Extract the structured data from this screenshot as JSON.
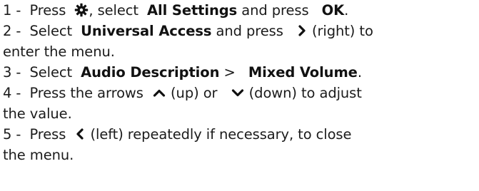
{
  "steps": [
    {
      "num": "1 -",
      "press": "Press",
      "icon1": "gear-icon",
      "sel": ", select",
      "all_settings": "All Settings",
      "and_press": "and press",
      "ok": "OK",
      "dot": "."
    },
    {
      "num": "2 -",
      "select": "Select",
      "universal_access": "Universal Access",
      "and_press": "and press",
      "icon1": "chevron-right-icon",
      "right": "(right) to",
      "cont": "enter the menu."
    },
    {
      "num": "3 -",
      "select": "Select",
      "audio_description": "Audio Description",
      "gt": ">",
      "mixed_volume": "Mixed Volume",
      "dot": "."
    },
    {
      "num": "4 -",
      "press_arrows": "Press the arrows",
      "icon1": "chevron-up-icon",
      "up_or": "(up) or",
      "icon2": "chevron-down-icon",
      "down": "(down) to adjust",
      "cont": "the value."
    },
    {
      "num": "5 -",
      "press": "Press",
      "icon1": "chevron-left-icon",
      "left": "(left) repeatedly if necessary, to close",
      "cont": "the menu."
    }
  ]
}
